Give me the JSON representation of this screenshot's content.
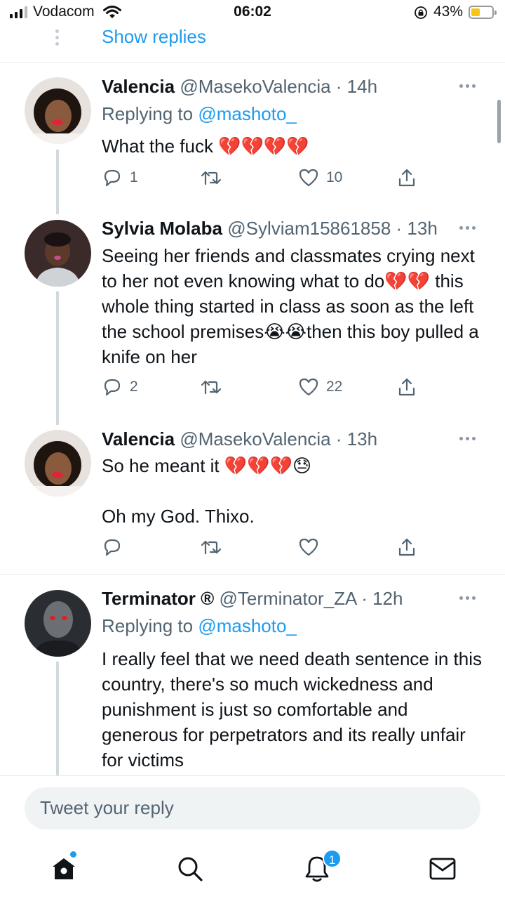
{
  "status_bar": {
    "carrier": "Vodacom",
    "time": "06:02",
    "battery_percent": "43%",
    "battery_level": 0.43,
    "signal_bars_active": 3,
    "signal_bars_total": 4
  },
  "thread": {
    "show_replies_label": "Show replies"
  },
  "tweets": [
    {
      "name": "Valencia",
      "handle": "@MasekoValencia",
      "time": "· 14h",
      "replying_prefix": "Replying to ",
      "replying_to": "@mashoto_",
      "text": "What the fuck 💔💔💔💔",
      "replies": "1",
      "retweets": "",
      "likes": "10"
    },
    {
      "name": "Sylvia Molaba",
      "handle": "@Sylviam15861858",
      "time": "· 13h",
      "text": "Seeing her friends and classmates crying next to her not even knowing what to do💔💔 this whole thing started in class as soon as the left the school premises😭😭then this boy pulled a knife on her",
      "replies": "2",
      "retweets": "",
      "likes": "22"
    },
    {
      "name": "Valencia",
      "handle": "@MasekoValencia",
      "time": "· 13h",
      "text": "So he meant it 💔💔💔😓\n\nOh my God. Thixo.",
      "replies": "",
      "retweets": "",
      "likes": ""
    },
    {
      "name": "Terminator ®",
      "handle": "@Terminator_ZA",
      "time": "· 12h",
      "replying_prefix": "Replying to ",
      "replying_to": "@mashoto_",
      "text": "I really feel that we need death sentence in this country, there's so much wickedness and punishment is just so comfortable and generous for perpetrators and its really unfair for victims"
    }
  ],
  "reply_box": {
    "placeholder": "Tweet your reply"
  },
  "bottom_nav": {
    "items": [
      "home-icon",
      "search-icon",
      "notifications-icon",
      "messages-icon"
    ],
    "notification_count": "1"
  },
  "colors": {
    "accent": "#1d9bf0",
    "text": "#0f1419",
    "muted": "#536471",
    "divider": "#e6e9ec",
    "battery": "#f5c518"
  }
}
